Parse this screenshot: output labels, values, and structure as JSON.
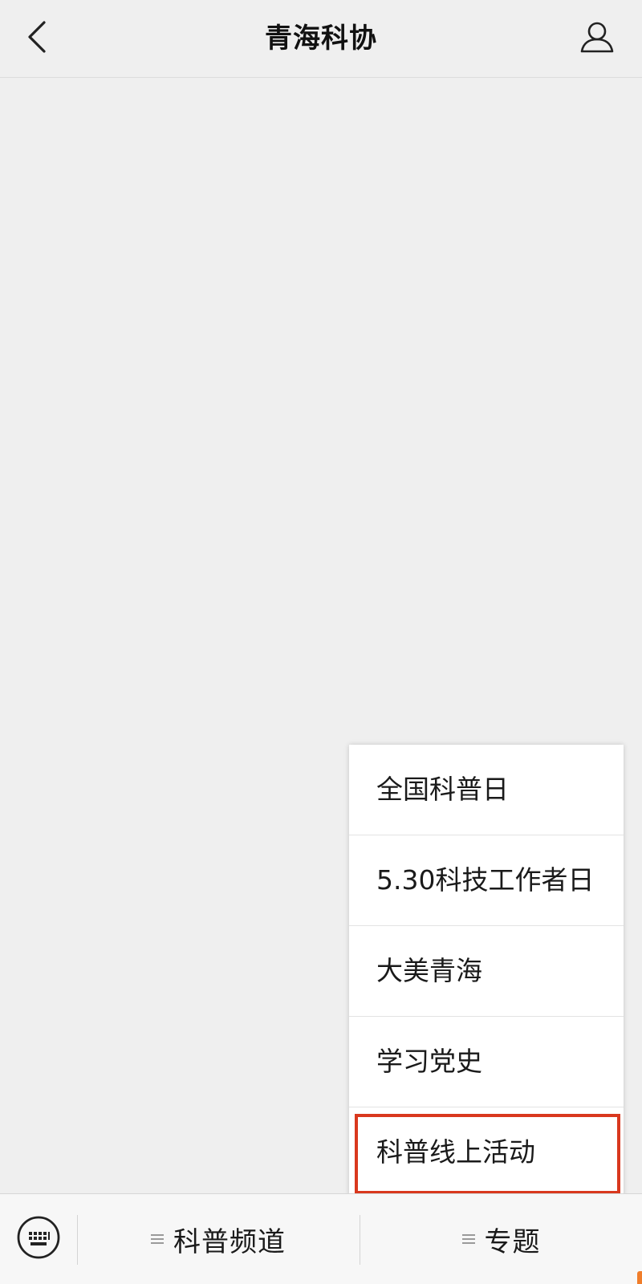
{
  "header": {
    "title": "青海科协",
    "back_icon": "chevron-left-icon",
    "profile_icon": "user-icon"
  },
  "submenu": {
    "items": [
      {
        "label": "全国科普日",
        "highlighted": false
      },
      {
        "label": "5.30科技工作者日",
        "highlighted": false
      },
      {
        "label": "大美青海",
        "highlighted": false
      },
      {
        "label": "学习党史",
        "highlighted": false
      },
      {
        "label": "科普线上活动",
        "highlighted": true
      }
    ],
    "highlight_color": "#d9381e"
  },
  "bottom_bar": {
    "keyboard_icon": "keyboard-icon",
    "menu_icon": "menu-lines-icon",
    "menus": [
      {
        "label": "科普频道"
      },
      {
        "label": "专题"
      }
    ]
  },
  "colors": {
    "background": "#efefef",
    "menu_background": "#ffffff",
    "accent_orange": "#f07d2a"
  }
}
